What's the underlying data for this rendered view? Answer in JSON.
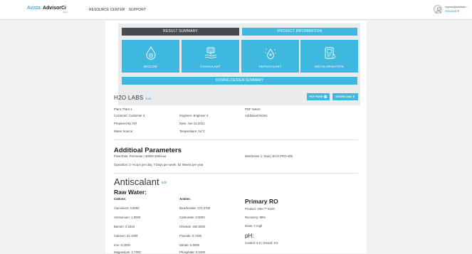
{
  "header": {
    "brand_avista": "Avista",
    "brand_advisor": "Advisor",
    "brand_ci": "Ci",
    "brand_sub": "Online",
    "nav": [
      "RESOURCE CENTER",
      "SUPPORT"
    ],
    "account_email": "mjamos@avistatec...",
    "account_label": "Account ▾"
  },
  "tabs": {
    "result_summary": "RESULT SUMMARY",
    "project_information": "PROJECT INFORMATION"
  },
  "tiles": [
    {
      "label": "BIOCIDE",
      "icon": "biocide-icon"
    },
    {
      "label": "COAGULANT",
      "icon": "coagulant-icon"
    },
    {
      "label": "ANTISCALANT",
      "icon": "antiscalant-icon"
    },
    {
      "label": "DECHLORINATION",
      "icon": "dechlorination-icon"
    }
  ],
  "dosing_label": "DOSING DESIGN SUMMARY",
  "project": {
    "title": "H2O LABS",
    "edit": "Edit",
    "pdf_label": "PDF PAGE 🖨",
    "download_label": "DOWNLOAD ⬇",
    "plant": "Plant: Plant 1",
    "customer": "Customer: Customer 3",
    "engineer": "Engineer: Engineer 3",
    "prepared_by": "Prepared By: KR",
    "date": "Date: Jun-14-2021",
    "water_source": "Water Source:",
    "temperature": "Temperature: 16°C",
    "pdf_notes": "PDF Notes:",
    "additional_notes": "Additional Notes:"
  },
  "params": {
    "title": "Additioal Parameters",
    "flow_rate": "Flow Rate: Permeate | 30000 M3/Hour",
    "membrane": "Membrane 1: Dow | ECO PRO-400",
    "operation": "Operation: 2- Hours per day, 7 Days per week, 52 Weeks per year"
  },
  "antiscalant": {
    "title": "Antiscalant",
    "edit": "Edit",
    "raw_water": "Raw Water:",
    "cations_header": "Cations:",
    "anions_header": "Anions:",
    "cations": [
      "Aluminium: 0.0000",
      "Ammonium: 1.0000",
      "Barium: 0.3310",
      "Calcium: 21.1000",
      "Iron: 0.0000",
      "Magnesium: 1.7000"
    ],
    "anions": [
      "Bicarbonate: 272.3700",
      "Carbonate: 0.0000",
      "Chloride: 340.0000",
      "Fluoride: 0.7200",
      "Nitrate: 5.0000",
      "Phosphate: 0.3100"
    ],
    "primary_ro_title": "Primary RO",
    "product": "Product: Vitec™ 5100",
    "recovery": "Recovery: 89%",
    "dose": "Dose: 2 mg/l",
    "ph_title": "pH:",
    "control": "Control: 8.5 | Dosed: 8.5"
  }
}
